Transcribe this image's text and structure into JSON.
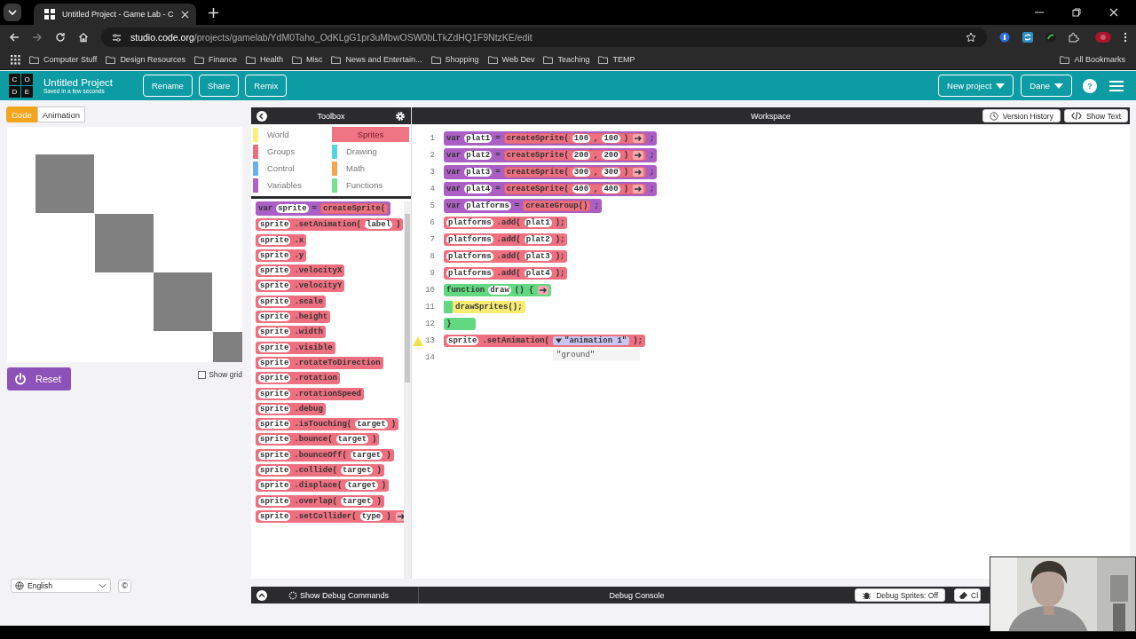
{
  "browser": {
    "tab_title": "Untitled Project - Game Lab - C",
    "url_host": "studio.code.org",
    "url_path": "/projects/gamelab/YdM0Taho_OdKLgG1pr3uMbwOSW0bLTkZdHQ1F9NtzKE/edit",
    "bookmarks": [
      "Computer Stuff",
      "Design Resources",
      "Finance",
      "Health",
      "Misc",
      "News and Entertain...",
      "Shopping",
      "Web Dev",
      "Teaching",
      "TEMP"
    ],
    "all_bookmarks": "All Bookmarks"
  },
  "header": {
    "logo": [
      "C",
      "O",
      "D",
      "E"
    ],
    "title": "Untitled Project",
    "subtitle": "Saved in a few seconds",
    "buttons": [
      "Rename",
      "Share",
      "Remix"
    ],
    "new_project": "New project",
    "user": "Dane",
    "help": "?"
  },
  "left": {
    "tabs": [
      {
        "label": "Code",
        "selected": true
      },
      {
        "label": "Animation",
        "selected": false
      }
    ],
    "show_grid": {
      "label": "Show grid",
      "checked": false
    },
    "reset": "Reset",
    "language": "English",
    "copyright": "©"
  },
  "toolbox": {
    "title": "Toolbox",
    "categories": [
      {
        "label": "World",
        "color": "#f8f07c",
        "selected": false
      },
      {
        "label": "Sprites",
        "color": "#ef7585",
        "selected": true
      },
      {
        "label": "Groups",
        "color": "#ea6f7e",
        "selected": false
      },
      {
        "label": "Drawing",
        "color": "#55d6df",
        "selected": false
      },
      {
        "label": "Control",
        "color": "#67b2ef",
        "selected": false
      },
      {
        "label": "Math",
        "color": "#f2a64f",
        "selected": false
      },
      {
        "label": "Variables",
        "color": "#b260c8",
        "selected": false
      },
      {
        "label": "Functions",
        "color": "#78e294",
        "selected": false
      }
    ],
    "blocks": [
      {
        "kind": "variable",
        "parts": [
          {
            "kind": "text",
            "text": "var"
          },
          {
            "kind": "slot",
            "text": "sprite"
          },
          {
            "kind": "text",
            "text": "="
          },
          {
            "kind": "block",
            "block": {
              "kind": "sprite",
              "parts": [
                {
                  "kind": "text",
                  "text": "createSprite("
                }
              ]
            }
          }
        ]
      },
      {
        "kind": "sprite",
        "parts": [
          {
            "kind": "slot",
            "text": "sprite"
          },
          {
            "kind": "text",
            "text": ".setAnimation("
          },
          {
            "kind": "slot",
            "text": "label"
          },
          {
            "kind": "text",
            "text": ")"
          }
        ]
      },
      {
        "kind": "sprite",
        "parts": [
          {
            "kind": "slot",
            "text": "sprite"
          },
          {
            "kind": "text",
            "text": ".x"
          }
        ]
      },
      {
        "kind": "sprite",
        "parts": [
          {
            "kind": "slot",
            "text": "sprite"
          },
          {
            "kind": "text",
            "text": ".y"
          }
        ]
      },
      {
        "kind": "sprite",
        "parts": [
          {
            "kind": "slot",
            "text": "sprite"
          },
          {
            "kind": "text",
            "text": ".velocityX"
          }
        ]
      },
      {
        "kind": "sprite",
        "parts": [
          {
            "kind": "slot",
            "text": "sprite"
          },
          {
            "kind": "text",
            "text": ".velocityY"
          }
        ]
      },
      {
        "kind": "sprite",
        "parts": [
          {
            "kind": "slot",
            "text": "sprite"
          },
          {
            "kind": "text",
            "text": ".scale"
          }
        ]
      },
      {
        "kind": "sprite",
        "parts": [
          {
            "kind": "slot",
            "text": "sprite"
          },
          {
            "kind": "text",
            "text": ".height"
          }
        ]
      },
      {
        "kind": "sprite",
        "parts": [
          {
            "kind": "slot",
            "text": "sprite"
          },
          {
            "kind": "text",
            "text": ".width"
          }
        ]
      },
      {
        "kind": "sprite",
        "parts": [
          {
            "kind": "slot",
            "text": "sprite"
          },
          {
            "kind": "text",
            "text": ".visible"
          }
        ]
      },
      {
        "kind": "sprite",
        "parts": [
          {
            "kind": "slot",
            "text": "sprite"
          },
          {
            "kind": "text",
            "text": ".rotateToDirection"
          }
        ]
      },
      {
        "kind": "sprite",
        "parts": [
          {
            "kind": "slot",
            "text": "sprite"
          },
          {
            "kind": "text",
            "text": ".rotation"
          }
        ]
      },
      {
        "kind": "sprite",
        "parts": [
          {
            "kind": "slot",
            "text": "sprite"
          },
          {
            "kind": "text",
            "text": ".rotationSpeed"
          }
        ]
      },
      {
        "kind": "sprite",
        "parts": [
          {
            "kind": "slot",
            "text": "sprite"
          },
          {
            "kind": "text",
            "text": ".debug"
          }
        ]
      },
      {
        "kind": "sprite",
        "parts": [
          {
            "kind": "slot",
            "text": "sprite"
          },
          {
            "kind": "text",
            "text": ".isTouching("
          },
          {
            "kind": "slot",
            "text": "target"
          },
          {
            "kind": "text",
            "text": ")"
          }
        ]
      },
      {
        "kind": "sprite",
        "parts": [
          {
            "kind": "slot",
            "text": "sprite"
          },
          {
            "kind": "text",
            "text": ".bounce("
          },
          {
            "kind": "slot",
            "text": "target"
          },
          {
            "kind": "text",
            "text": ")"
          }
        ]
      },
      {
        "kind": "sprite",
        "parts": [
          {
            "kind": "slot",
            "text": "sprite"
          },
          {
            "kind": "text",
            "text": ".bounceOff("
          },
          {
            "kind": "slot",
            "text": "target"
          },
          {
            "kind": "text",
            "text": ")"
          }
        ]
      },
      {
        "kind": "sprite",
        "parts": [
          {
            "kind": "slot",
            "text": "sprite"
          },
          {
            "kind": "text",
            "text": ".collide("
          },
          {
            "kind": "slot",
            "text": "target"
          },
          {
            "kind": "text",
            "text": ")"
          }
        ]
      },
      {
        "kind": "sprite",
        "parts": [
          {
            "kind": "slot",
            "text": "sprite"
          },
          {
            "kind": "text",
            "text": ".displace("
          },
          {
            "kind": "slot",
            "text": "target"
          },
          {
            "kind": "text",
            "text": ")"
          }
        ]
      },
      {
        "kind": "sprite",
        "parts": [
          {
            "kind": "slot",
            "text": "sprite"
          },
          {
            "kind": "text",
            "text": ".overlap("
          },
          {
            "kind": "slot",
            "text": "target"
          },
          {
            "kind": "text",
            "text": ")"
          }
        ]
      },
      {
        "kind": "sprite",
        "parts": [
          {
            "kind": "slot",
            "text": "sprite"
          },
          {
            "kind": "text",
            "text": ".setCollider("
          },
          {
            "kind": "slot",
            "text": "type"
          },
          {
            "kind": "text",
            "text": ")"
          },
          {
            "kind": "arrow"
          }
        ]
      }
    ]
  },
  "workspace": {
    "title": "Workspace",
    "version_history": "Version History",
    "show_text": "Show Text",
    "lines": [
      {
        "number": "1",
        "warning": false,
        "block": {
          "kind": "variable",
          "parts": [
            {
              "kind": "text",
              "text": "var"
            },
            {
              "kind": "slot",
              "text": "plat1"
            },
            {
              "kind": "text",
              "text": "="
            },
            {
              "kind": "block",
              "block": {
                "kind": "sprite",
                "parts": [
                  {
                    "kind": "text",
                    "text": "createSprite("
                  },
                  {
                    "kind": "slot",
                    "text": "100"
                  },
                  {
                    "kind": "text",
                    "text": ","
                  },
                  {
                    "kind": "slot",
                    "text": "100"
                  },
                  {
                    "kind": "text",
                    "text": ")"
                  },
                  {
                    "kind": "arrow"
                  }
                ]
              }
            },
            {
              "kind": "text",
              "text": ";"
            }
          ]
        }
      },
      {
        "number": "2",
        "warning": false,
        "block": {
          "kind": "variable",
          "parts": [
            {
              "kind": "text",
              "text": "var"
            },
            {
              "kind": "slot",
              "text": "plat2"
            },
            {
              "kind": "text",
              "text": "="
            },
            {
              "kind": "block",
              "block": {
                "kind": "sprite",
                "parts": [
                  {
                    "kind": "text",
                    "text": "createSprite("
                  },
                  {
                    "kind": "slot",
                    "text": "200"
                  },
                  {
                    "kind": "text",
                    "text": ","
                  },
                  {
                    "kind": "slot",
                    "text": "200"
                  },
                  {
                    "kind": "text",
                    "text": ")"
                  },
                  {
                    "kind": "arrow"
                  }
                ]
              }
            },
            {
              "kind": "text",
              "text": ";"
            }
          ]
        }
      },
      {
        "number": "3",
        "warning": false,
        "block": {
          "kind": "variable",
          "parts": [
            {
              "kind": "text",
              "text": "var"
            },
            {
              "kind": "slot",
              "text": "plat3"
            },
            {
              "kind": "text",
              "text": "="
            },
            {
              "kind": "block",
              "block": {
                "kind": "sprite",
                "parts": [
                  {
                    "kind": "text",
                    "text": "createSprite("
                  },
                  {
                    "kind": "slot",
                    "text": "300"
                  },
                  {
                    "kind": "text",
                    "text": ","
                  },
                  {
                    "kind": "slot",
                    "text": "300"
                  },
                  {
                    "kind": "text",
                    "text": ")"
                  },
                  {
                    "kind": "arrow"
                  }
                ]
              }
            },
            {
              "kind": "text",
              "text": ";"
            }
          ]
        }
      },
      {
        "number": "4",
        "warning": false,
        "block": {
          "kind": "variable",
          "parts": [
            {
              "kind": "text",
              "text": "var"
            },
            {
              "kind": "slot",
              "text": "plat4"
            },
            {
              "kind": "text",
              "text": "="
            },
            {
              "kind": "block",
              "block": {
                "kind": "sprite",
                "parts": [
                  {
                    "kind": "text",
                    "text": "createSprite("
                  },
                  {
                    "kind": "slot",
                    "text": "400"
                  },
                  {
                    "kind": "text",
                    "text": ","
                  },
                  {
                    "kind": "slot",
                    "text": "400"
                  },
                  {
                    "kind": "text",
                    "text": ")"
                  },
                  {
                    "kind": "arrow"
                  }
                ]
              }
            },
            {
              "kind": "text",
              "text": ";"
            }
          ]
        }
      },
      {
        "number": "5",
        "warning": false,
        "block": {
          "kind": "variable",
          "parts": [
            {
              "kind": "text",
              "text": "var"
            },
            {
              "kind": "slot",
              "text": "platforms"
            },
            {
              "kind": "text",
              "text": "="
            },
            {
              "kind": "block",
              "block": {
                "kind": "sprite",
                "parts": [
                  {
                    "kind": "text",
                    "text": "createGroup()"
                  }
                ]
              }
            },
            {
              "kind": "text",
              "text": ";"
            }
          ]
        }
      },
      {
        "number": "6",
        "warning": false,
        "block": {
          "kind": "sprite",
          "parts": [
            {
              "kind": "slot",
              "text": "platforms"
            },
            {
              "kind": "text",
              "text": ".add("
            },
            {
              "kind": "slot",
              "text": "plat1"
            },
            {
              "kind": "text",
              "text": ");"
            }
          ]
        }
      },
      {
        "number": "7",
        "warning": false,
        "block": {
          "kind": "sprite",
          "parts": [
            {
              "kind": "slot",
              "text": "platforms"
            },
            {
              "kind": "text",
              "text": ".add("
            },
            {
              "kind": "slot",
              "text": "plat2"
            },
            {
              "kind": "text",
              "text": ");"
            }
          ]
        }
      },
      {
        "number": "8",
        "warning": false,
        "block": {
          "kind": "sprite",
          "parts": [
            {
              "kind": "slot",
              "text": "platforms"
            },
            {
              "kind": "text",
              "text": ".add("
            },
            {
              "kind": "slot",
              "text": "plat3"
            },
            {
              "kind": "text",
              "text": ");"
            }
          ]
        }
      },
      {
        "number": "9",
        "warning": false,
        "block": {
          "kind": "sprite",
          "parts": [
            {
              "kind": "slot",
              "text": "platforms"
            },
            {
              "kind": "text",
              "text": ".add("
            },
            {
              "kind": "slot",
              "text": "plat4"
            },
            {
              "kind": "text",
              "text": ");"
            }
          ]
        }
      },
      {
        "number": "10",
        "warning": false,
        "block": {
          "kind": "function",
          "parts": [
            {
              "kind": "text",
              "text": "function"
            },
            {
              "kind": "slot",
              "text": "draw"
            },
            {
              "kind": "text",
              "text": "() {"
            },
            {
              "kind": "arrow"
            }
          ]
        },
        "body": [
          {
            "number": "11",
            "warning": false,
            "block": {
              "kind": "drawing",
              "parts": [
                {
                  "kind": "text",
                  "text": "drawSprites();"
                }
              ]
            }
          }
        ],
        "end": {
          "number": "12",
          "text": "}"
        }
      },
      {
        "number": "13",
        "warning": true,
        "block": {
          "kind": "sprite",
          "parts": [
            {
              "kind": "slot",
              "text": "sprite"
            },
            {
              "kind": "text",
              "text": ".setAnimation("
            },
            {
              "kind": "dropdown",
              "text": "\"animation 1\"",
              "selected": true,
              "options": [
                "\"ground\""
              ]
            },
            {
              "kind": "text",
              "text": ");"
            }
          ]
        }
      },
      {
        "number": "14",
        "warning": false
      }
    ]
  },
  "debug": {
    "show_commands": "Show Debug Commands",
    "console": "Debug Console",
    "sprites": "Debug Sprites: Off",
    "clear": "Cl"
  }
}
